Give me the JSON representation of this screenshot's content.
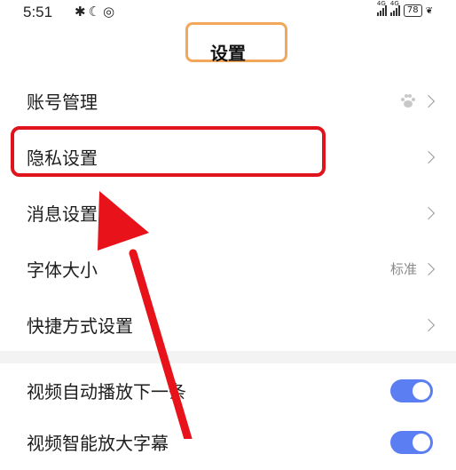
{
  "status_bar": {
    "time": "5:51",
    "signal1_label": "4G",
    "signal2_label": "4G",
    "battery": "78"
  },
  "header": {
    "title": "设置"
  },
  "settings": [
    {
      "label": "账号管理",
      "value": ""
    },
    {
      "label": "隐私设置",
      "value": ""
    },
    {
      "label": "消息设置",
      "value": ""
    },
    {
      "label": "字体大小",
      "value": "标准"
    },
    {
      "label": "快捷方式设置",
      "value": ""
    }
  ],
  "toggles": [
    {
      "label": "视频自动播放下一条",
      "on": true
    },
    {
      "label": "视频智能放大字幕",
      "on": true
    }
  ],
  "colors": {
    "highlight_orange": "#f2a75b",
    "highlight_red": "#e0141c",
    "toggle_on": "#5b7ff2",
    "arrow": "#e8121b"
  }
}
